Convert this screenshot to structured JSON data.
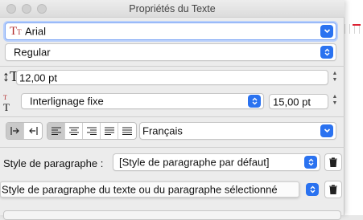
{
  "window": {
    "title": "Propriétés du Texte"
  },
  "font": {
    "name": "Arial",
    "style": "Regular",
    "size": "12,00 pt"
  },
  "leading": {
    "mode": "Interlignage fixe",
    "value": "15,00 pt"
  },
  "language": "Français",
  "paragraph": {
    "label": "Style de paragraphe :",
    "value": "[Style de paragraphe par défaut]",
    "tooltip": "Style de paragraphe du texte ou du paragraphe sélectionné"
  },
  "icons": {
    "font": "font-icon",
    "size": "font-size-icon",
    "leading": "line-spacing-icon",
    "trash": "trash-icon"
  },
  "colors": {
    "accent": "#2a72f0"
  }
}
